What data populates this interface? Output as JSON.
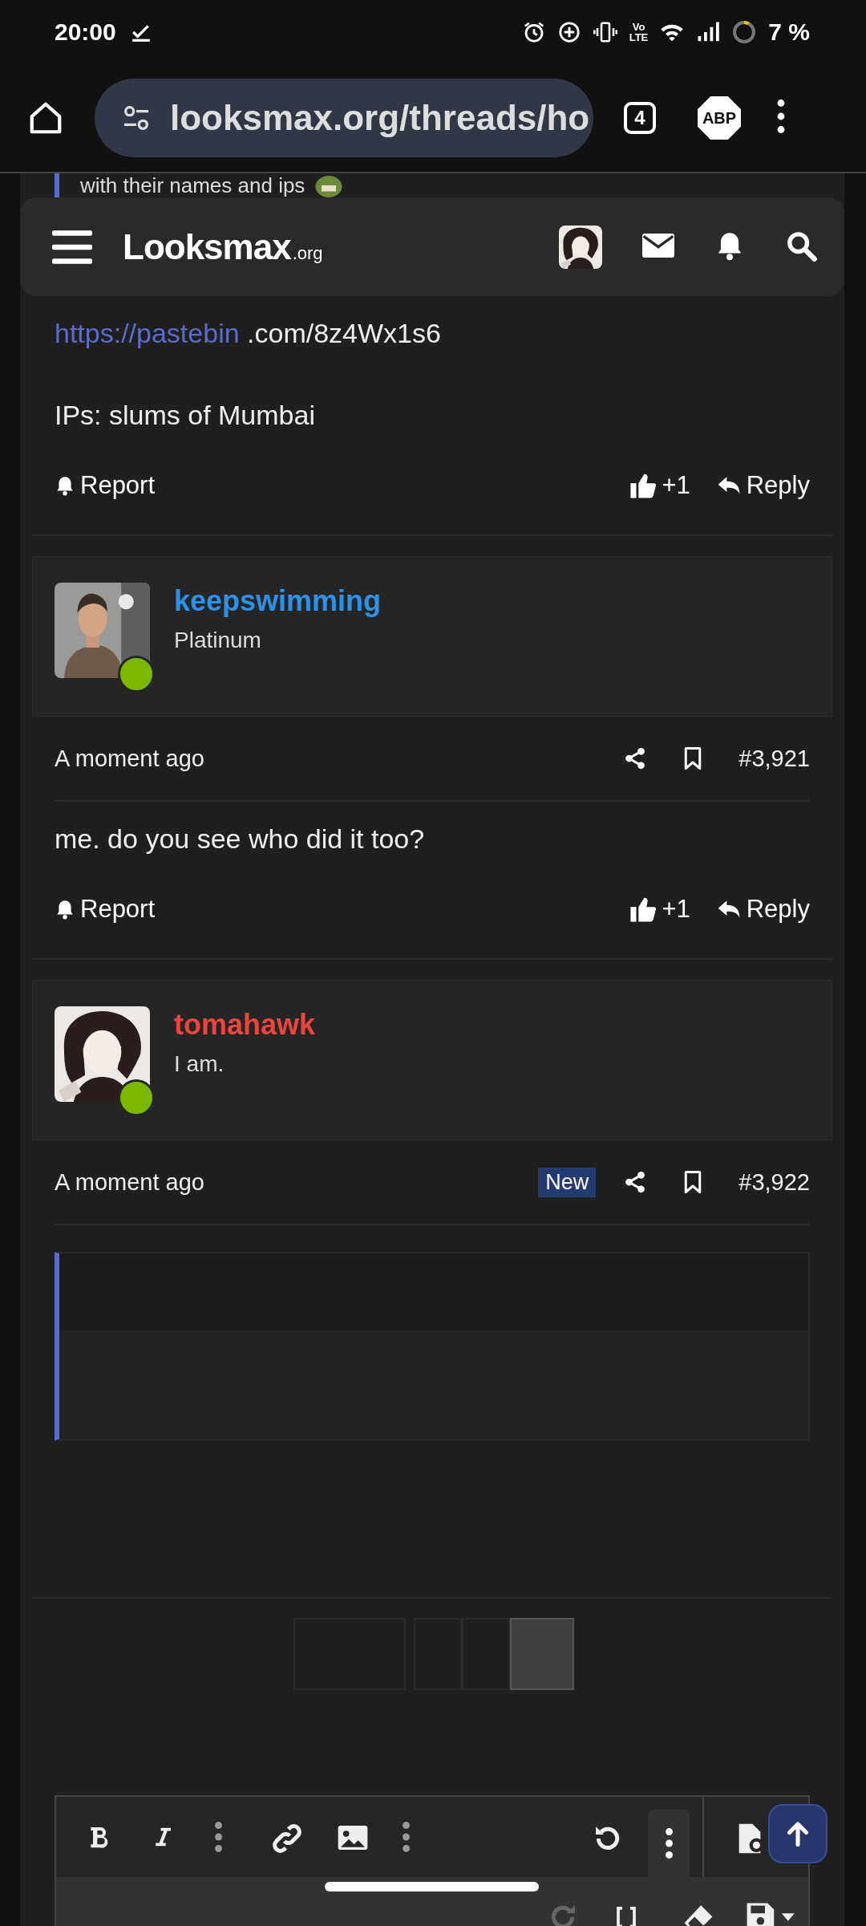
{
  "status_bar": {
    "time": "20:00",
    "volte_top": "Vo",
    "volte_bottom": "LTE",
    "battery": "7 %"
  },
  "browser": {
    "url": "looksmax.org/threads/ho",
    "tab_count": "4",
    "adblock": "ABP"
  },
  "behind_header_text": "with their names and ips",
  "site_header": {
    "logo": "Looksmax",
    "logo_suffix": ".org"
  },
  "posts": [
    {
      "paragraphs": [
        {
          "link": "https://pastebin",
          "text": " .com/8z4Wx1s6"
        },
        {
          "text": "IPs: slums of Mumbai"
        }
      ],
      "actions": {
        "report": "Report",
        "likes": "+1",
        "reply": "Reply"
      }
    },
    {
      "user": {
        "name": "keepswimming",
        "title": "Platinum",
        "color": "#2b92e8",
        "online": true
      },
      "meta": {
        "time": "A moment ago",
        "number": "#3,921"
      },
      "paragraphs": [
        {
          "text": "me. do you see who did it too?"
        }
      ],
      "actions": {
        "report": "Report",
        "likes": "+1",
        "reply": "Reply"
      }
    },
    {
      "user": {
        "name": "tomahawk",
        "title": "I am.",
        "color": "#e8453c",
        "online": true
      },
      "meta": {
        "time": "A moment ago",
        "badge": "New",
        "number": "#3,922"
      },
      "quote": true
    }
  ],
  "pagination": [
    {
      "selected": false
    },
    {
      "selected": false
    },
    {
      "selected": false
    },
    {
      "selected": true
    }
  ]
}
